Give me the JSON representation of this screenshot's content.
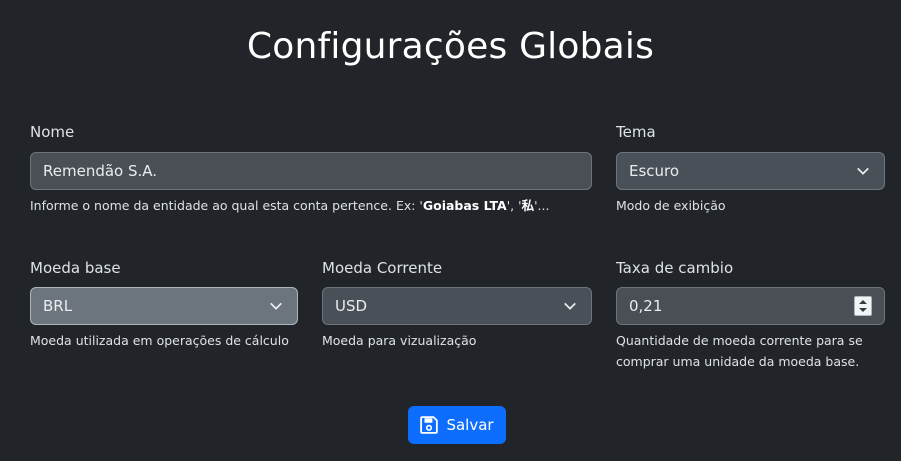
{
  "page": {
    "title": "Configurações Globais"
  },
  "nome": {
    "label": "Nome",
    "value": "Remendão S.A.",
    "help_prefix": "Informe o nome da entidade ao qual esta conta pertence. Ex: '",
    "help_ex1": "Goiabas LTA",
    "help_mid": "', '",
    "help_ex2": "私",
    "help_suffix": "'..."
  },
  "tema": {
    "label": "Tema",
    "value": "Escuro",
    "help": "Modo de exibição",
    "icon": "chevron-down-icon"
  },
  "moeda_base": {
    "label": "Moeda base",
    "value": "BRL",
    "help": "Moeda utilizada em operações de cálculo",
    "icon": "chevron-down-icon"
  },
  "moeda_corrente": {
    "label": "Moeda Corrente",
    "value": "USD",
    "help": "Moeda para vizualização",
    "icon": "chevron-down-icon"
  },
  "taxa": {
    "label": "Taxa de cambio",
    "value": "0,21",
    "help_line1": "Quantidade de moeda corrente para se",
    "help_line2": "comprar uma unidade da moeda base."
  },
  "save_button": {
    "label": "Salvar",
    "icon": "save-icon",
    "color": "#0d6efd"
  }
}
